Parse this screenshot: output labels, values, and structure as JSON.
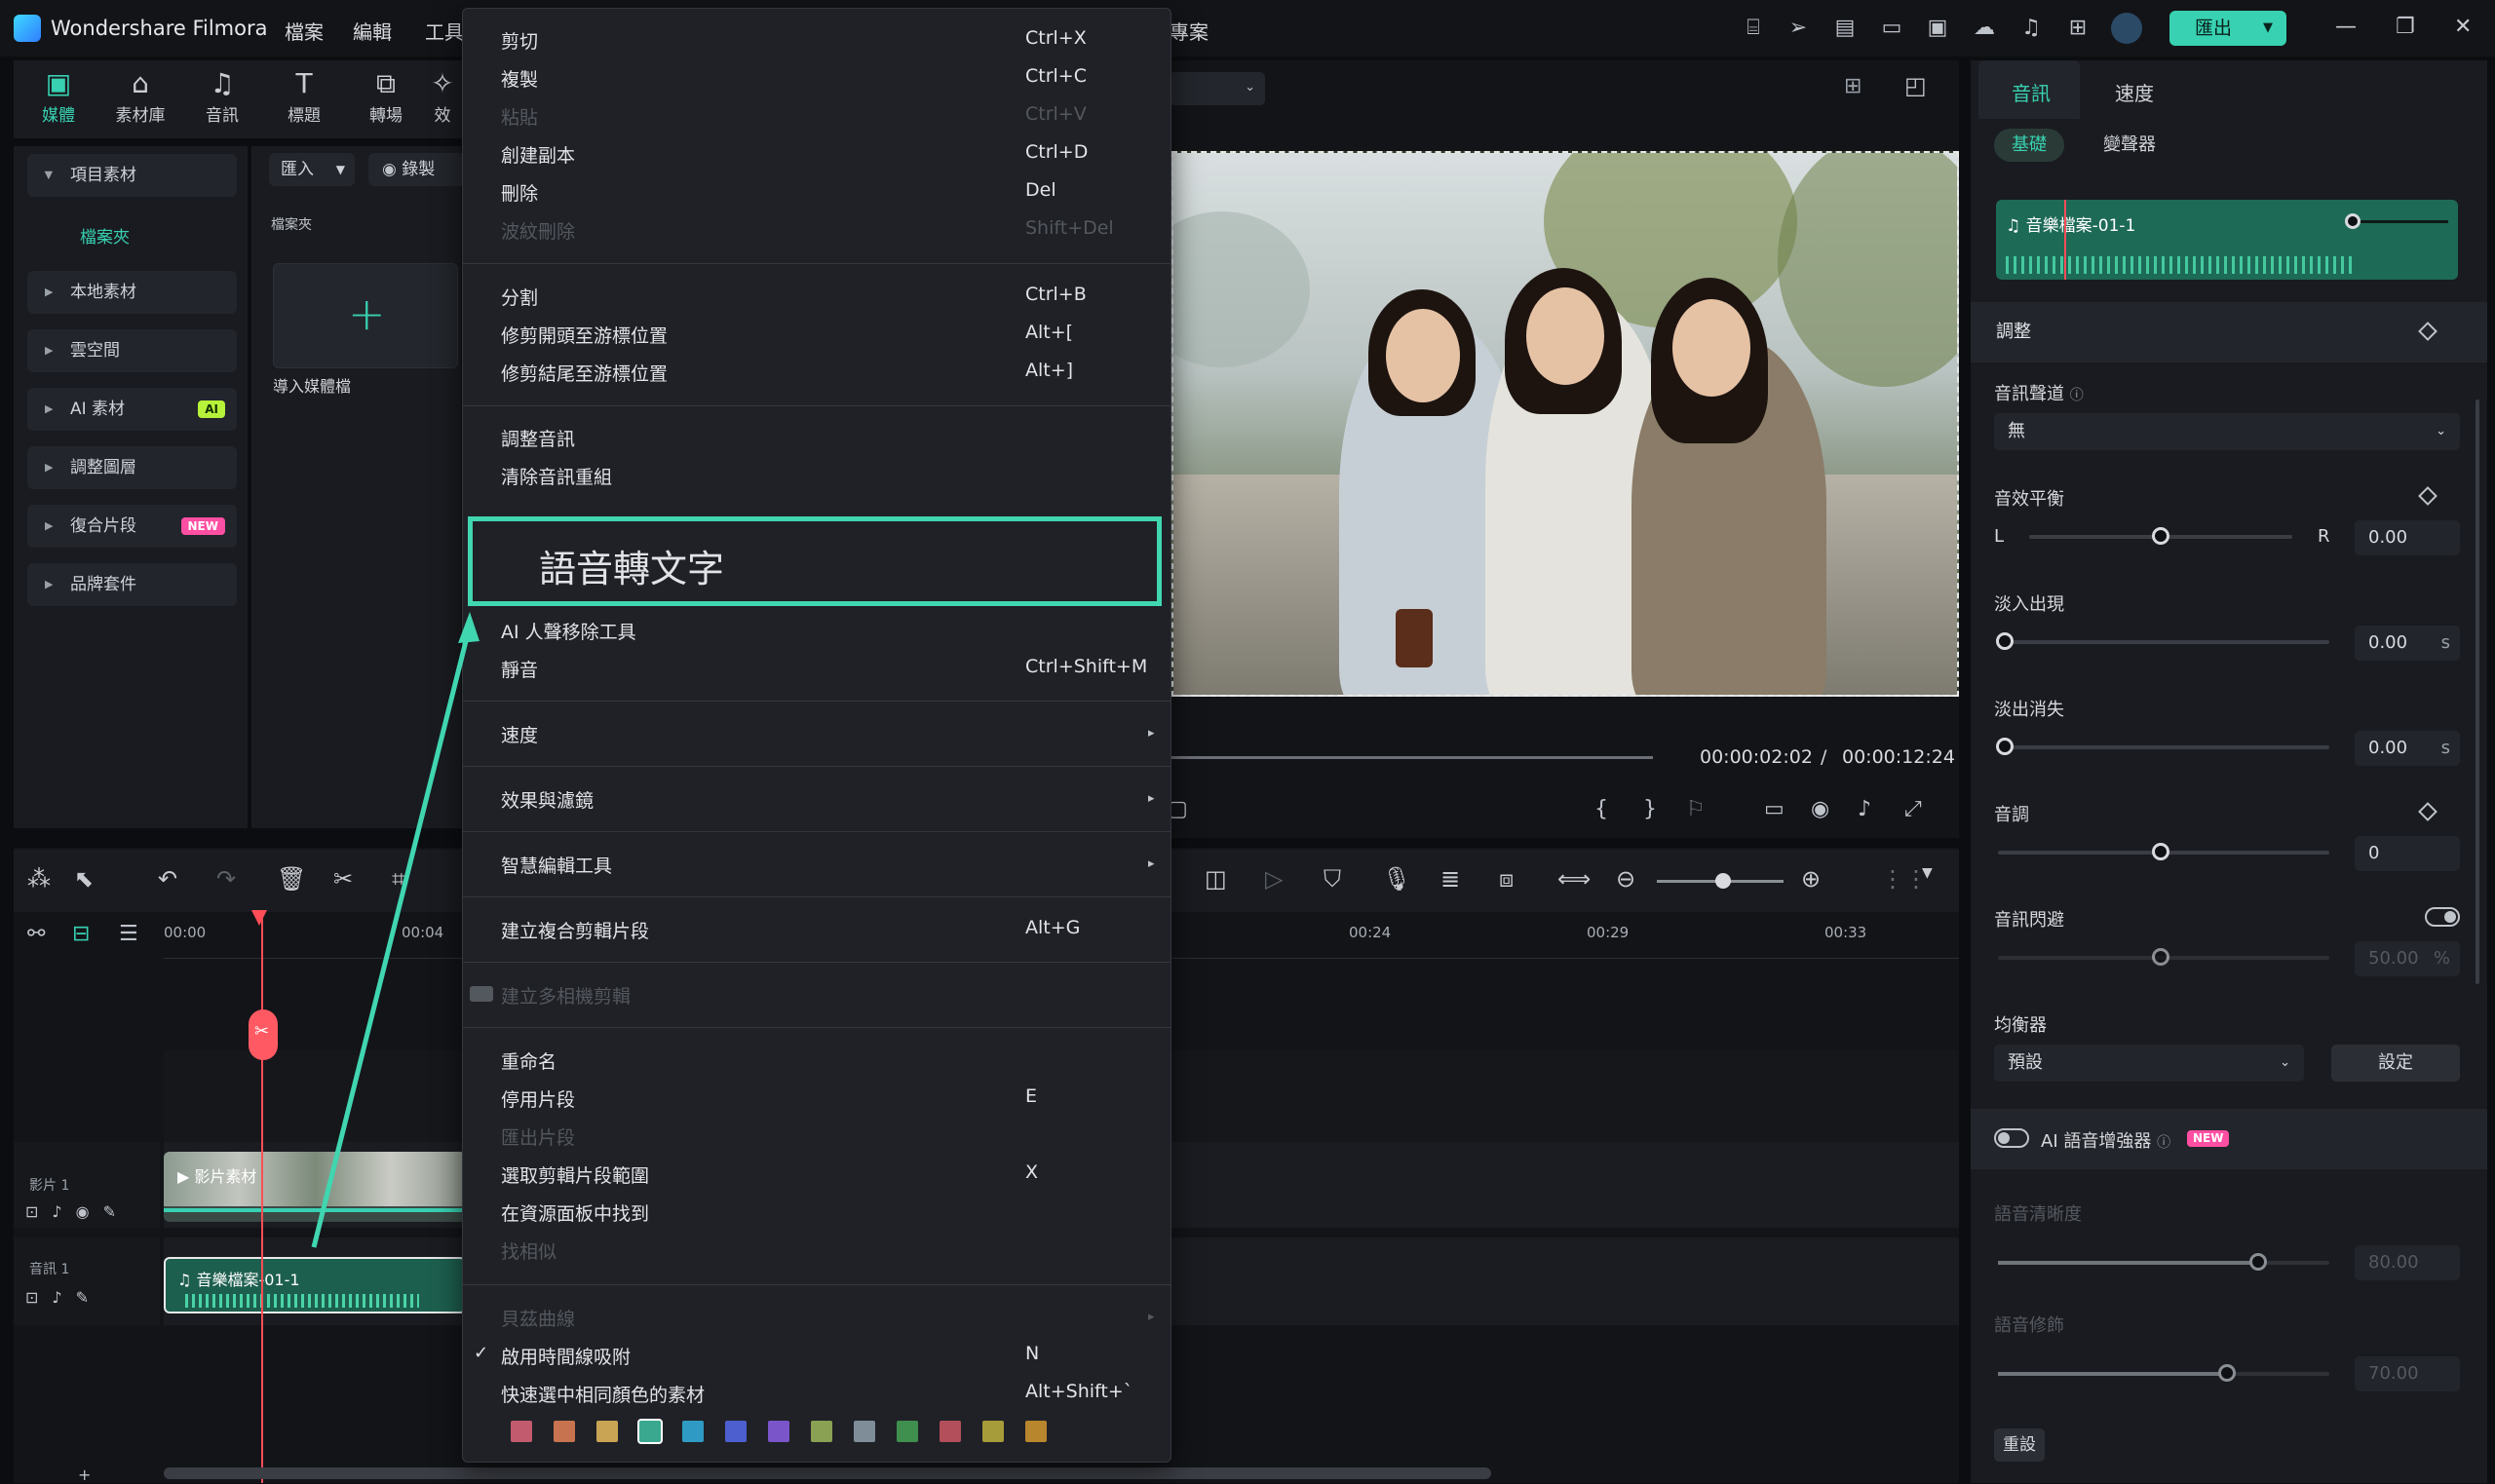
{
  "titlebar": {
    "app_title": "Wondershare Filmora",
    "menus": [
      "檔案",
      "編輯",
      "工具"
    ],
    "project_fragment": "專案",
    "export_label": "匯出"
  },
  "media_tabs": [
    {
      "label": "媒體",
      "icon": "media-icon",
      "active": true
    },
    {
      "label": "素材庫",
      "icon": "stock-icon"
    },
    {
      "label": "音訊",
      "icon": "music-icon"
    },
    {
      "label": "標題",
      "icon": "title-icon"
    },
    {
      "label": "轉場",
      "icon": "transition-icon"
    },
    {
      "label": "效",
      "icon": "effects-icon"
    }
  ],
  "leftnav": {
    "project_media": "項目素材",
    "folder": "檔案夾",
    "items": [
      {
        "label": "本地素材"
      },
      {
        "label": "雲空間"
      },
      {
        "label": "AI 素材",
        "badge": "AI"
      },
      {
        "label": "調整圖層"
      },
      {
        "label": "復合片段",
        "badge": "NEW"
      },
      {
        "label": "品牌套件"
      }
    ]
  },
  "media_panel": {
    "import_label": "匯入",
    "record_label": "錄製",
    "folder_header": "檔案夾",
    "import_tile_label": "導入媒體檔"
  },
  "preview": {
    "current_time": "00:00:02:02",
    "separator": "/",
    "total_time": "00:00:12:24"
  },
  "context_menu": {
    "groups": [
      [
        {
          "label": "剪切",
          "shortcut": "Ctrl+X"
        },
        {
          "label": "複製",
          "shortcut": "Ctrl+C"
        },
        {
          "label": "粘貼",
          "shortcut": "Ctrl+V",
          "disabled": true
        },
        {
          "label": "創建副本",
          "shortcut": "Ctrl+D"
        },
        {
          "label": "刪除",
          "shortcut": "Del"
        },
        {
          "label": "波紋刪除",
          "shortcut": "Shift+Del",
          "disabled": true
        }
      ],
      [
        {
          "label": "分割",
          "shortcut": "Ctrl+B"
        },
        {
          "label": "修剪開頭至游標位置",
          "shortcut": "Alt+["
        },
        {
          "label": "修剪結尾至游標位置",
          "shortcut": "Alt+]"
        }
      ],
      [
        {
          "label": "調整音訊"
        },
        {
          "label": "清除音訊重組"
        }
      ]
    ],
    "highlighted": "語音轉文字",
    "after_highlight": [
      {
        "label": "AI 人聲移除工具"
      },
      {
        "label": "靜音",
        "shortcut": "Ctrl+Shift+M"
      }
    ],
    "submenus": [
      "速度",
      "效果與濾鏡",
      "智慧編輯工具"
    ],
    "compound": {
      "label": "建立複合剪輯片段",
      "shortcut": "Alt+G"
    },
    "multicam": "建立多相機剪輯",
    "group_clip": [
      {
        "label": "重命名"
      },
      {
        "label": "停用片段",
        "shortcut": "E"
      },
      {
        "label": "匯出片段",
        "disabled": true
      },
      {
        "label": "選取剪輯片段範圍",
        "shortcut": "X"
      },
      {
        "label": "在資源面板中找到"
      },
      {
        "label": "找相似",
        "disabled": true
      }
    ],
    "bezier": "貝茲曲線",
    "snap": {
      "label": "啟用時間線吸附",
      "shortcut": "N",
      "checked": true
    },
    "select_color": {
      "label": "快速選中相同顏色的素材",
      "shortcut": "Alt+Shift+`"
    },
    "swatches": [
      "#c25b6e",
      "#c8734f",
      "#c9a454",
      "#3aa88f",
      "#2f9bc4",
      "#4d5fcf",
      "#7a55c9",
      "#8aa052",
      "#7f8d99",
      "#3f8f4e",
      "#b24f5a",
      "#a79c3a",
      "#b8862c"
    ]
  },
  "timeline": {
    "ticks": [
      "00:00",
      "00:04",
      "00:24",
      "00:29",
      "00:33"
    ],
    "video_track": "影片 1",
    "audio_track": "音訊 1",
    "video_clip_label": "影片素材",
    "audio_clip_label": "音樂檔案-01-1"
  },
  "right_panel": {
    "tabs": [
      "音訊",
      "速度"
    ],
    "subtabs": [
      "基礎",
      "變聲器"
    ],
    "clip_name": "音樂檔案-01-1",
    "adjust_title": "調整",
    "channel_label": "音訊聲道",
    "channel_value": "無",
    "balance_label": "音效平衡",
    "balance_l": "L",
    "balance_r": "R",
    "balance_value": "0.00",
    "fadein_label": "淡入出現",
    "fadein_value": "0.00",
    "fadeout_label": "淡出消失",
    "fadeout_value": "0.00",
    "unit_s": "s",
    "pitch_label": "音調",
    "pitch_value": "0",
    "ducking_label": "音訊閃避",
    "ducking_value": "50.00",
    "unit_pct": "%",
    "eq_label": "均衡器",
    "eq_value": "預設",
    "eq_button": "設定",
    "ai_enhancer": "AI 語音增強器",
    "ai_badge": "NEW",
    "clarity_label": "語音清晰度",
    "clarity_value": "80.00",
    "beautify_label": "語音修飾",
    "beautify_value": "70.00",
    "reset_label": "重設"
  }
}
